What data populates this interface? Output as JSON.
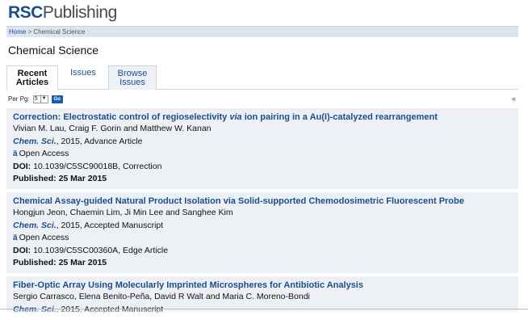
{
  "header": {
    "logo_rsc": "RSC",
    "logo_publishing": "Publishing"
  },
  "breadcrumb": {
    "home": "Home",
    "separator": " > ",
    "current": "Chemical Science"
  },
  "journal_title": "Chemical Science",
  "tabs": [
    {
      "label": "Recent Articles",
      "active": true
    },
    {
      "label": "Issues",
      "active": false
    },
    {
      "label": "Browse Issues",
      "active": false
    }
  ],
  "paging": {
    "per_page_label": "Per Pg:",
    "per_page_value": "5",
    "go_label": "Go",
    "prev_arrow": "«"
  },
  "articles": [
    {
      "title_pre": "Correction: Electrostatic control of regioselectivity ",
      "title_italic": "via",
      "title_post": " ion pairing in a Au(I)-catalyzed rearrangement",
      "authors": "Vivian M. Lau, Craig F. Gorin and Matthew W. Kanan",
      "journal": "Chem. Sci.",
      "year_type": ", 2015, Advance Article",
      "access": "Open Access",
      "doi_label": "DOI:",
      "doi": " 10.1039/C5SC90018B, Correction",
      "published_label": "Published:",
      "published": "  25 Mar 2015"
    },
    {
      "title_pre": "Chemical Assay-guided Natural Product Isolation via Solid-supported Chemodosimetric Fluorescent Probe",
      "title_italic": "",
      "title_post": "",
      "authors": "Hongjun Jeon, Chaemin Lim, Ji Min Lee and Sanghee Kim",
      "journal": "Chem. Sci.",
      "year_type": ", 2015, Accepted Manuscript",
      "access": "Open Access",
      "doi_label": "DOI:",
      "doi": " 10.1039/C5SC00360A, Edge Article",
      "published_label": "Published:",
      "published": "  25 Mar 2015"
    },
    {
      "title_pre": "Fiber-Optic Array Using Molecularly Imprinted Microspheres for Antibiotic Analysis",
      "title_italic": "",
      "title_post": "",
      "authors": "Sergio Carrasco, Elena Benito-Peña, David R Walt and Maria C. Moreno-Bondi",
      "journal": "Chem. Sci.",
      "year_type": ", 2015, Accepted Manuscript"
    }
  ]
}
